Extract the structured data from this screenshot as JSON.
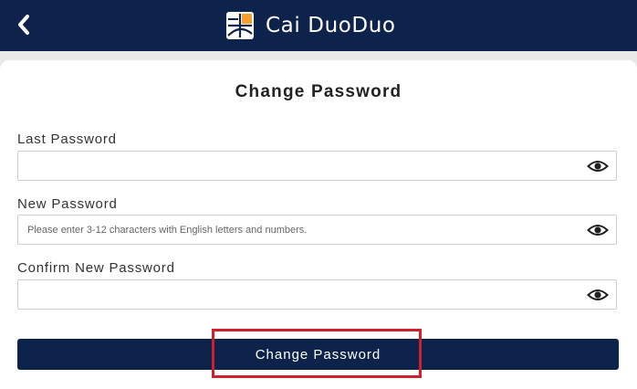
{
  "header": {
    "title": "Cai DuoDuo",
    "back_icon": "chevron-left-icon",
    "logo_icon": "app-logo-icon",
    "bg_color": "#0e234b",
    "logo_accent": "#f2a12e"
  },
  "form": {
    "title": "Change Password",
    "fields": [
      {
        "label": "Last Password",
        "value": "",
        "placeholder": "",
        "icon": "eye-icon"
      },
      {
        "label": "New Password",
        "value": "",
        "placeholder": "Please enter 3-12 characters with English letters and numbers.",
        "icon": "eye-icon"
      },
      {
        "label": "Confirm New Password",
        "value": "",
        "placeholder": "",
        "icon": "eye-icon"
      }
    ],
    "submit_label": "Change Password",
    "submit_color": "#0e234b",
    "highlight_color": "#d0202e"
  }
}
